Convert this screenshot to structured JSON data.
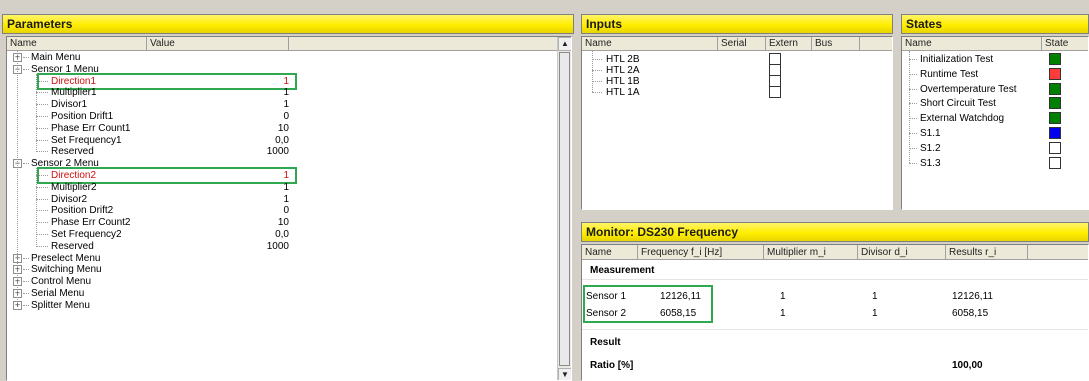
{
  "parameters": {
    "title": "Parameters",
    "col_name": "Name",
    "col_value": "Value",
    "tree": [
      {
        "label": "Main Menu",
        "expander": "+",
        "level": 0
      },
      {
        "label": "Sensor 1 Menu",
        "expander": "−",
        "level": 0
      },
      {
        "label": "Direction1",
        "value": "1",
        "level": 1,
        "highlight": true
      },
      {
        "label": "Multiplier1",
        "value": "1",
        "level": 1
      },
      {
        "label": "Divisor1",
        "value": "1",
        "level": 1
      },
      {
        "label": "Position Drift1",
        "value": "0",
        "level": 1
      },
      {
        "label": "Phase Err Count1",
        "value": "10",
        "level": 1
      },
      {
        "label": "Set Frequency1",
        "value": "0,0",
        "level": 1
      },
      {
        "label": "Reserved",
        "value": "1000",
        "level": 1
      },
      {
        "label": "Sensor 2 Menu",
        "expander": "−",
        "level": 0
      },
      {
        "label": "Direction2",
        "value": "1",
        "level": 1,
        "highlight": true
      },
      {
        "label": "Multiplier2",
        "value": "1",
        "level": 1
      },
      {
        "label": "Divisor2",
        "value": "1",
        "level": 1
      },
      {
        "label": "Position Drift2",
        "value": "0",
        "level": 1
      },
      {
        "label": "Phase Err Count2",
        "value": "10",
        "level": 1
      },
      {
        "label": "Set Frequency2",
        "value": "0,0",
        "level": 1
      },
      {
        "label": "Reserved",
        "value": "1000",
        "level": 1
      },
      {
        "label": "Preselect Menu",
        "expander": "+",
        "level": 0
      },
      {
        "label": "Switching Menu",
        "expander": "+",
        "level": 0
      },
      {
        "label": "Control Menu",
        "expander": "+",
        "level": 0
      },
      {
        "label": "Serial Menu",
        "expander": "+",
        "level": 0
      },
      {
        "label": "Splitter Menu",
        "expander": "+",
        "level": 0
      }
    ],
    "scroll_up": "▲",
    "scroll_down": "▼"
  },
  "inputs": {
    "title": "Inputs",
    "cols": [
      "Name",
      "Serial",
      "Extern",
      "Bus"
    ],
    "items": [
      "HTL 2B",
      "HTL 2A",
      "HTL 1B",
      "HTL 1A"
    ]
  },
  "states": {
    "title": "States",
    "cols": [
      "Name",
      "State"
    ],
    "items": [
      {
        "label": "Initialization Test",
        "color": "#008000"
      },
      {
        "label": "Runtime Test",
        "color": "#ff3b3b"
      },
      {
        "label": "Overtemperature Test",
        "color": "#008000"
      },
      {
        "label": "Short Circuit Test",
        "color": "#008000"
      },
      {
        "label": "External Watchdog",
        "color": "#008000"
      },
      {
        "label": "S1.1",
        "color": "#0000ee"
      },
      {
        "label": "S1.2",
        "color": "#ffffff"
      },
      {
        "label": "S1.3",
        "color": "#ffffff"
      }
    ]
  },
  "monitor": {
    "title": "Monitor: DS230 Frequency",
    "cols": [
      "Name",
      "Frequency f_i [Hz]",
      "Multiplier m_i",
      "Divisor d_i",
      "Results r_i"
    ],
    "measurement_label": "Measurement",
    "rows": [
      {
        "name": "Sensor 1",
        "freq": "12126,11",
        "mult": "1",
        "div": "1",
        "result": "12126,11"
      },
      {
        "name": "Sensor 2",
        "freq": "6058,15",
        "mult": "1",
        "div": "1",
        "result": "6058,15"
      }
    ],
    "result_label": "Result",
    "ratio_label": "Ratio [%]",
    "ratio_value": "100,00"
  },
  "colors": {
    "title_yellow": "#ffee00",
    "highlight_green": "#2fa84f",
    "red_text": "#d01010"
  }
}
